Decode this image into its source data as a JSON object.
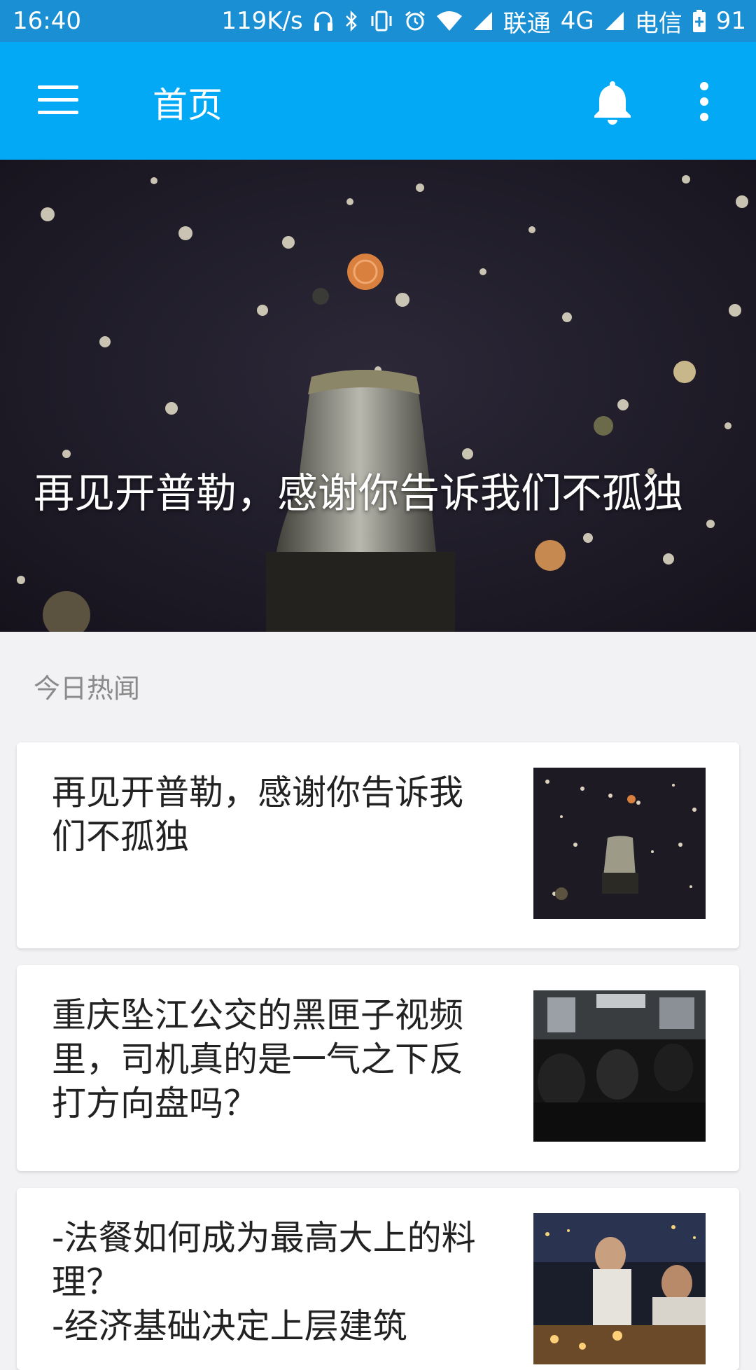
{
  "status_bar": {
    "time": "16:40",
    "speed": "119K/s",
    "carrier1": "联通",
    "network": "4G",
    "carrier2": "电信",
    "battery": "91",
    "icons": [
      "headphones-icon",
      "bluetooth-icon",
      "vibrate-icon",
      "alarm-icon",
      "wifi-icon",
      "signal-icon",
      "signal-icon",
      "battery-icon"
    ]
  },
  "app_bar": {
    "title": "首页",
    "icons": [
      "menu-icon",
      "bell-icon",
      "more-vert-icon"
    ],
    "color": "#03a9f4"
  },
  "banner": {
    "title": "再见开普勒，感谢你告诉我们不孤独",
    "page_count": 5,
    "active_index": 0
  },
  "section": {
    "label": "今日热闻"
  },
  "stories": [
    {
      "title": "再见开普勒，感谢你告诉我\n们不孤独",
      "image": "space-telescope-thumbnail"
    },
    {
      "title": "重庆坠江公交的黑匣子视频\n里，司机真的是一气之下反\n打方向盘吗？",
      "image": "bus-interior-thumbnail"
    },
    {
      "title": "-法餐如何成为最高大上的料\n理？\n-经济基础决定上层建筑",
      "image": "dining-thumbnail"
    }
  ]
}
